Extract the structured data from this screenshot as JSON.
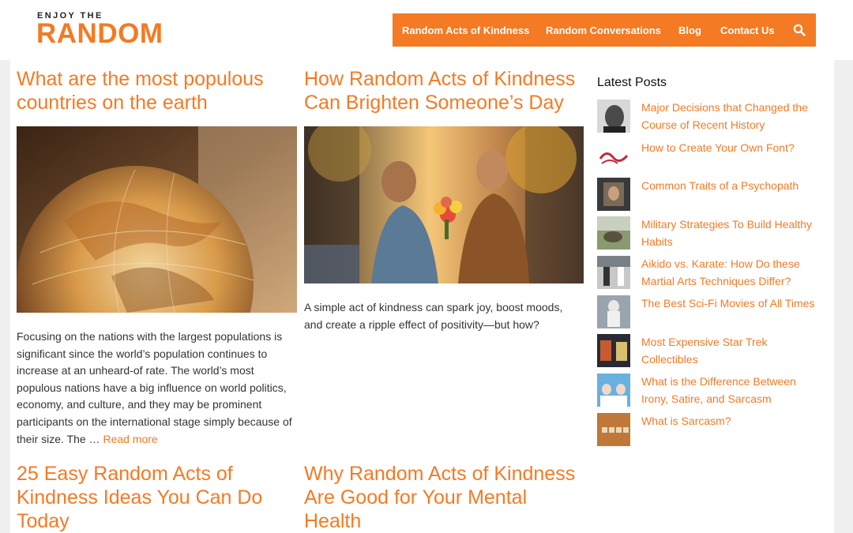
{
  "logo": {
    "top_text": "ENJOY THE",
    "main_text": "RANDOM"
  },
  "nav": {
    "items": [
      {
        "label": "Random Acts of Kindness"
      },
      {
        "label": "Random Conversations"
      },
      {
        "label": "Blog"
      },
      {
        "label": "Contact Us"
      }
    ],
    "search_icon": "search-icon"
  },
  "posts": [
    {
      "title": "What are the most populous countries on the earth",
      "excerpt": "Focusing on the nations with the largest populations is significant since the world’s population continues to increase at an unheard-of rate. The world’s most populous nations have a big influence on world politics, economy, and culture, and they may be prominent participants on the international stage simply because of their size. The …",
      "read_more": "Read more"
    },
    {
      "title": "How Random Acts of Kindness Can Brighten Someone’s Day",
      "excerpt": "A simple act of kindness can spark joy, boost moods, and create a ripple effect of positivity—but how?"
    },
    {
      "title": "25 Easy Random Acts of Kindness Ideas You Can Do Today"
    },
    {
      "title": "Why Random Acts of Kindness Are Good for Your Mental Health"
    }
  ],
  "sidebar": {
    "title": "Latest Posts",
    "items": [
      {
        "label": "Major Decisions that Changed the Course of Recent History"
      },
      {
        "label": "How to Create Your Own Font?"
      },
      {
        "label": "Common Traits of a Psychopath"
      },
      {
        "label": "Military Strategies To Build Healthy Habits"
      },
      {
        "label": "Aikido vs. Karate: How Do these Martial Arts Techniques Differ?"
      },
      {
        "label": "The Best Sci-Fi Movies of All Times"
      },
      {
        "label": "Most Expensive Star Trek Collectibles"
      },
      {
        "label": "What is the Difference Between Irony, Satire, and Sarcasm"
      },
      {
        "label": "What is Sarcasm?"
      }
    ]
  },
  "colors": {
    "accent": "#f47a24",
    "text": "#333333"
  }
}
